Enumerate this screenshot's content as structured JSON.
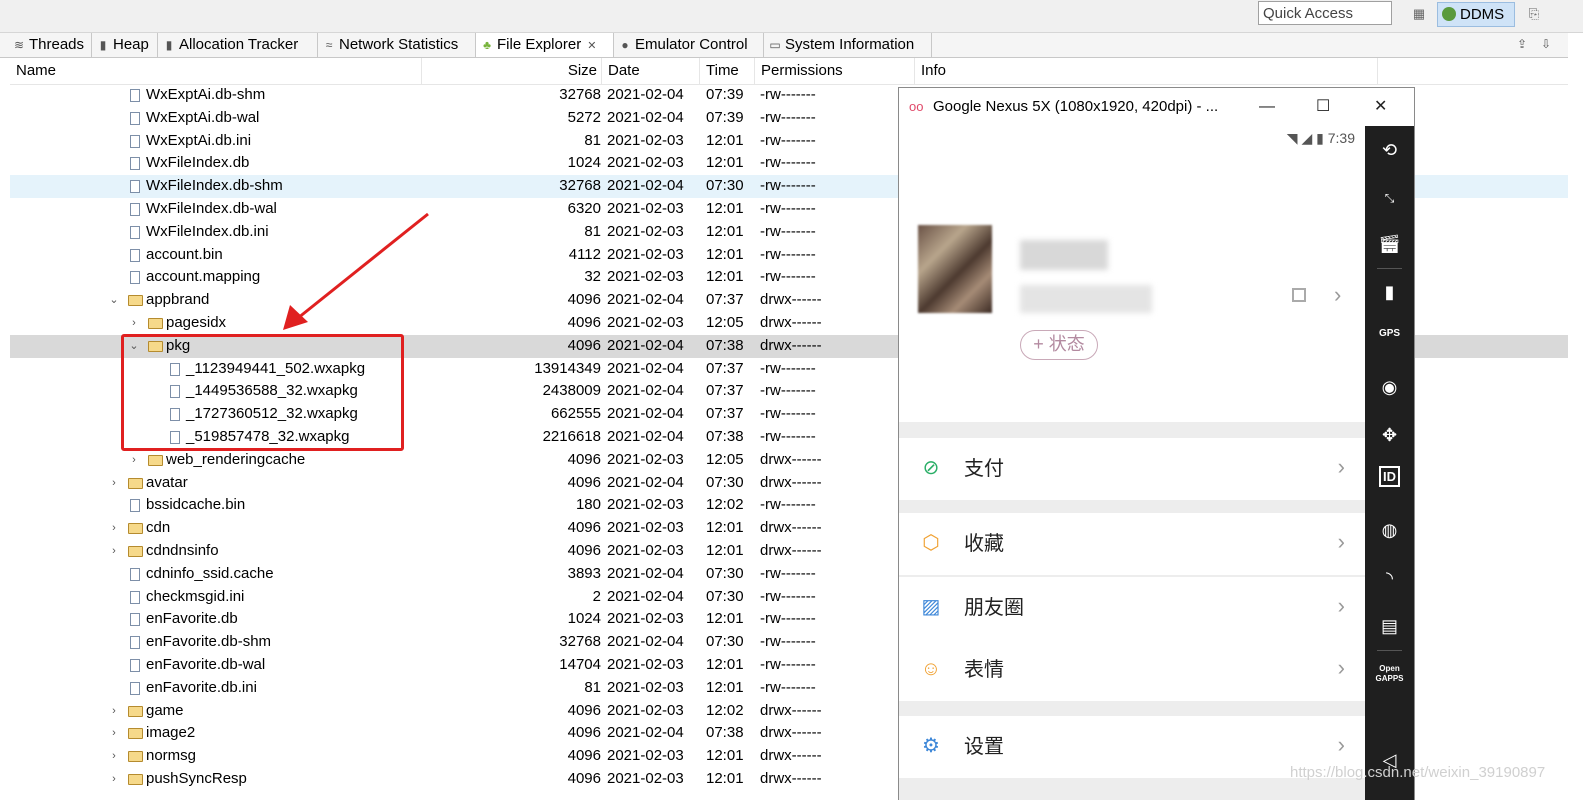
{
  "toolbar": {
    "quick_access_placeholder": "Quick Access",
    "perspective": "DDMS"
  },
  "tabs": [
    {
      "label": "Threads",
      "icon": "threads-icon"
    },
    {
      "label": "Heap",
      "icon": "heap-icon"
    },
    {
      "label": "Allocation Tracker",
      "icon": "allocation-icon"
    },
    {
      "label": "Network Statistics",
      "icon": "network-icon"
    },
    {
      "label": "File Explorer",
      "icon": "android-icon",
      "active": true
    },
    {
      "label": "Emulator Control",
      "icon": "emulator-icon"
    },
    {
      "label": "System Information",
      "icon": "sysinfo-icon"
    }
  ],
  "columns": [
    "Name",
    "Size",
    "Date",
    "Time",
    "Permissions",
    "Info"
  ],
  "files": [
    {
      "name": "WxExptAi.db-shm",
      "size": "32768",
      "date": "2021-02-04",
      "time": "07:39",
      "perm": "-rw-------",
      "type": "file",
      "depth": 0
    },
    {
      "name": "WxExptAi.db-wal",
      "size": "5272",
      "date": "2021-02-04",
      "time": "07:39",
      "perm": "-rw-------",
      "type": "file",
      "depth": 0
    },
    {
      "name": "WxExptAi.db.ini",
      "size": "81",
      "date": "2021-02-03",
      "time": "12:01",
      "perm": "-rw-------",
      "type": "file",
      "depth": 0
    },
    {
      "name": "WxFileIndex.db",
      "size": "1024",
      "date": "2021-02-03",
      "time": "12:01",
      "perm": "-rw-------",
      "type": "file",
      "depth": 0
    },
    {
      "name": "WxFileIndex.db-shm",
      "size": "32768",
      "date": "2021-02-04",
      "time": "07:30",
      "perm": "-rw-------",
      "type": "file",
      "depth": 0,
      "hover": true
    },
    {
      "name": "WxFileIndex.db-wal",
      "size": "6320",
      "date": "2021-02-03",
      "time": "12:01",
      "perm": "-rw-------",
      "type": "file",
      "depth": 0
    },
    {
      "name": "WxFileIndex.db.ini",
      "size": "81",
      "date": "2021-02-03",
      "time": "12:01",
      "perm": "-rw-------",
      "type": "file",
      "depth": 0
    },
    {
      "name": "account.bin",
      "size": "4112",
      "date": "2021-02-03",
      "time": "12:01",
      "perm": "-rw-------",
      "type": "file",
      "depth": 0
    },
    {
      "name": "account.mapping",
      "size": "32",
      "date": "2021-02-03",
      "time": "12:01",
      "perm": "-rw-------",
      "type": "file",
      "depth": 0
    },
    {
      "name": "appbrand",
      "size": "4096",
      "date": "2021-02-04",
      "time": "07:37",
      "perm": "drwx------",
      "type": "dir",
      "depth": 0,
      "expanded": true
    },
    {
      "name": "pagesidx",
      "size": "4096",
      "date": "2021-02-03",
      "time": "12:05",
      "perm": "drwx------",
      "type": "dir",
      "depth": 1,
      "expanded": false
    },
    {
      "name": "pkg",
      "size": "4096",
      "date": "2021-02-04",
      "time": "07:38",
      "perm": "drwx------",
      "type": "dir",
      "depth": 1,
      "expanded": true,
      "selected": true
    },
    {
      "name": "_1123949441_502.wxapkg",
      "size": "13914349",
      "date": "2021-02-04",
      "time": "07:37",
      "perm": "-rw-------",
      "type": "file",
      "depth": 2
    },
    {
      "name": "_1449536588_32.wxapkg",
      "size": "2438009",
      "date": "2021-02-04",
      "time": "07:37",
      "perm": "-rw-------",
      "type": "file",
      "depth": 2
    },
    {
      "name": "_1727360512_32.wxapkg",
      "size": "662555",
      "date": "2021-02-04",
      "time": "07:37",
      "perm": "-rw-------",
      "type": "file",
      "depth": 2
    },
    {
      "name": "_519857478_32.wxapkg",
      "size": "2216618",
      "date": "2021-02-04",
      "time": "07:38",
      "perm": "-rw-------",
      "type": "file",
      "depth": 2
    },
    {
      "name": "web_renderingcache",
      "size": "4096",
      "date": "2021-02-03",
      "time": "12:05",
      "perm": "drwx------",
      "type": "dir",
      "depth": 1,
      "expanded": false
    },
    {
      "name": "avatar",
      "size": "4096",
      "date": "2021-02-04",
      "time": "07:30",
      "perm": "drwx------",
      "type": "dir",
      "depth": 0,
      "expanded": false
    },
    {
      "name": "bssidcache.bin",
      "size": "180",
      "date": "2021-02-03",
      "time": "12:02",
      "perm": "-rw-------",
      "type": "file",
      "depth": 0
    },
    {
      "name": "cdn",
      "size": "4096",
      "date": "2021-02-03",
      "time": "12:01",
      "perm": "drwx------",
      "type": "dir",
      "depth": 0,
      "expanded": false
    },
    {
      "name": "cdndnsinfo",
      "size": "4096",
      "date": "2021-02-03",
      "time": "12:01",
      "perm": "drwx------",
      "type": "dir",
      "depth": 0,
      "expanded": false
    },
    {
      "name": "cdninfo_ssid.cache",
      "size": "3893",
      "date": "2021-02-04",
      "time": "07:30",
      "perm": "-rw-------",
      "type": "file",
      "depth": 0
    },
    {
      "name": "checkmsgid.ini",
      "size": "2",
      "date": "2021-02-04",
      "time": "07:30",
      "perm": "-rw-------",
      "type": "file",
      "depth": 0
    },
    {
      "name": "enFavorite.db",
      "size": "1024",
      "date": "2021-02-03",
      "time": "12:01",
      "perm": "-rw-------",
      "type": "file",
      "depth": 0
    },
    {
      "name": "enFavorite.db-shm",
      "size": "32768",
      "date": "2021-02-04",
      "time": "07:30",
      "perm": "-rw-------",
      "type": "file",
      "depth": 0
    },
    {
      "name": "enFavorite.db-wal",
      "size": "14704",
      "date": "2021-02-03",
      "time": "12:01",
      "perm": "-rw-------",
      "type": "file",
      "depth": 0
    },
    {
      "name": "enFavorite.db.ini",
      "size": "81",
      "date": "2021-02-03",
      "time": "12:01",
      "perm": "-rw-------",
      "type": "file",
      "depth": 0
    },
    {
      "name": "game",
      "size": "4096",
      "date": "2021-02-03",
      "time": "12:02",
      "perm": "drwx------",
      "type": "dir",
      "depth": 0,
      "expanded": false
    },
    {
      "name": "image2",
      "size": "4096",
      "date": "2021-02-04",
      "time": "07:38",
      "perm": "drwx------",
      "type": "dir",
      "depth": 0,
      "expanded": false
    },
    {
      "name": "normsg",
      "size": "4096",
      "date": "2021-02-03",
      "time": "12:01",
      "perm": "drwx------",
      "type": "dir",
      "depth": 0,
      "expanded": false
    },
    {
      "name": "pushSyncResp",
      "size": "4096",
      "date": "2021-02-03",
      "time": "12:01",
      "perm": "drwx------",
      "type": "dir",
      "depth": 0,
      "expanded": false
    }
  ],
  "emulator": {
    "title": "Google Nexus 5X (1080x1920, 420dpi) - ...",
    "clock": "7:39",
    "status_button": "+ 状态",
    "menu": [
      {
        "label": "支付",
        "icon": "wallet-icon",
        "color": "#2aae67"
      },
      {
        "label": "收藏",
        "icon": "favorites-cube-icon",
        "color": "#f0a030"
      },
      {
        "label": "朋友圈",
        "icon": "moments-photo-icon",
        "color": "#3d87d8"
      },
      {
        "label": "表情",
        "icon": "emoji-icon",
        "color": "#f0a030"
      },
      {
        "label": "设置",
        "icon": "settings-gear-icon",
        "color": "#3d87d8"
      }
    ],
    "side_tools": [
      "rotate-icon",
      "one-to-one-icon",
      "clapper-icon",
      "battery-icon",
      "gps-icon",
      "camera-icon",
      "dpad-icon",
      "id-icon",
      "media-icon",
      "rss-icon",
      "sms-icon",
      "opengapps-icon",
      "back-icon"
    ],
    "side_labels": {
      "gps": "GPS",
      "id": "ID",
      "opengapps": "Open GAPPS"
    }
  },
  "watermark": "https://blog.csdn.net/weixin_39190897",
  "colors": {
    "highlight": "#e02020",
    "selected_row": "#d9d9d9",
    "hover_row": "#e5f3fb",
    "ddms_active": "#cfe3f7"
  }
}
